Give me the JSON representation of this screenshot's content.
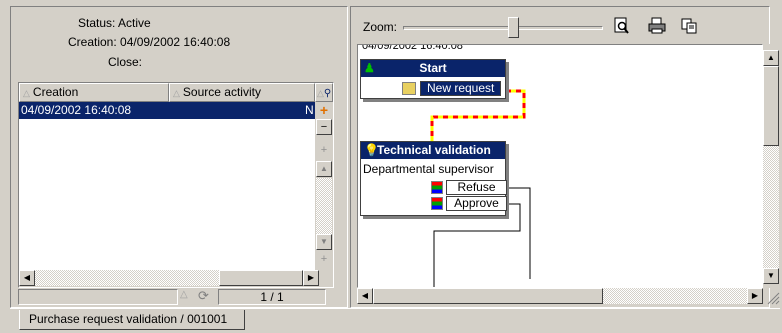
{
  "record_info": {
    "status": "Status: Active",
    "creation": "Creation: 04/09/2002 16:40:08",
    "close": "Close:"
  },
  "grid": {
    "columns": [
      "Creation",
      "Source activity"
    ],
    "rows": [
      {
        "creation": "04/09/2002 16:40:08",
        "source_activity": "N"
      }
    ],
    "pager": "1 / 1"
  },
  "toolbar": {
    "zoom_label": "Zoom:",
    "zoom_level": 0.55
  },
  "diagram": {
    "timestamp": "04/09/2002 16:40:08",
    "start_node": {
      "title": "Start",
      "port": "New request"
    },
    "validation_node": {
      "title": "Technical validation",
      "subtitle": "Departmental supervisor",
      "ports": [
        "Refuse",
        "Approve"
      ]
    },
    "link_colors": {
      "active": "#ff0000",
      "active_alt": "#ffff00",
      "normal": "#000000"
    }
  },
  "tabs": [
    "Purchase request validation / 001001"
  ],
  "colors": {
    "selection": "#0a246a",
    "face": "#d4d0c8"
  }
}
